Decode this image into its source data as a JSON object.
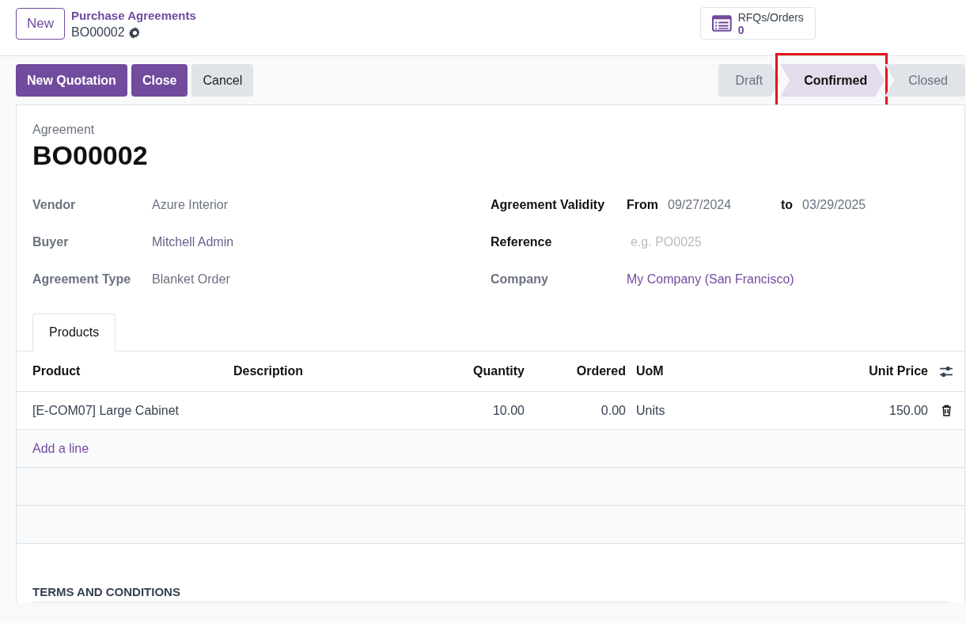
{
  "control_panel": {
    "new_button": "New",
    "breadcrumb": "Purchase Agreements",
    "record": "BO00002",
    "smart_button": {
      "label": "RFQs/Orders",
      "value": "0"
    }
  },
  "actions": [
    {
      "label": "New Quotation",
      "kind": "primary"
    },
    {
      "label": "Close",
      "kind": "primary"
    },
    {
      "label": "Cancel",
      "kind": "secondary"
    }
  ],
  "stages": [
    {
      "label": "Draft",
      "selected": false
    },
    {
      "label": "Confirmed",
      "selected": true
    },
    {
      "label": "Closed",
      "selected": false
    }
  ],
  "form": {
    "title_label": "Agreement",
    "title": "BO00002",
    "left_fields": [
      {
        "label": "Vendor",
        "value": "Azure Interior",
        "kind": "text"
      },
      {
        "label": "Buyer",
        "value": "Mitchell Admin",
        "kind": "link"
      },
      {
        "label": "Agreement Type",
        "value": "Blanket Order",
        "kind": "text"
      }
    ],
    "validity": {
      "label": "Agreement Validity",
      "from_label": "From",
      "from": "09/27/2024",
      "to_label": "to",
      "to": "03/29/2025"
    },
    "right_fields": [
      {
        "label": "Reference",
        "placeholder": "e.g. PO0025",
        "kind": "input"
      },
      {
        "label": "Company",
        "value": "My Company (San Francisco)",
        "kind": "link"
      }
    ],
    "tabs": [
      {
        "label": "Products",
        "selected": true
      }
    ],
    "table": {
      "columns": [
        "Product",
        "Description",
        "Quantity",
        "Ordered",
        "UoM",
        "Unit Price"
      ],
      "rows": [
        [
          "[E-COM07] Large Cabinet",
          "",
          "10.00",
          "0.00",
          "Units",
          "150.00"
        ]
      ],
      "add_line": "Add a line"
    },
    "terms_heading": "TERMS AND CONDITIONS"
  }
}
